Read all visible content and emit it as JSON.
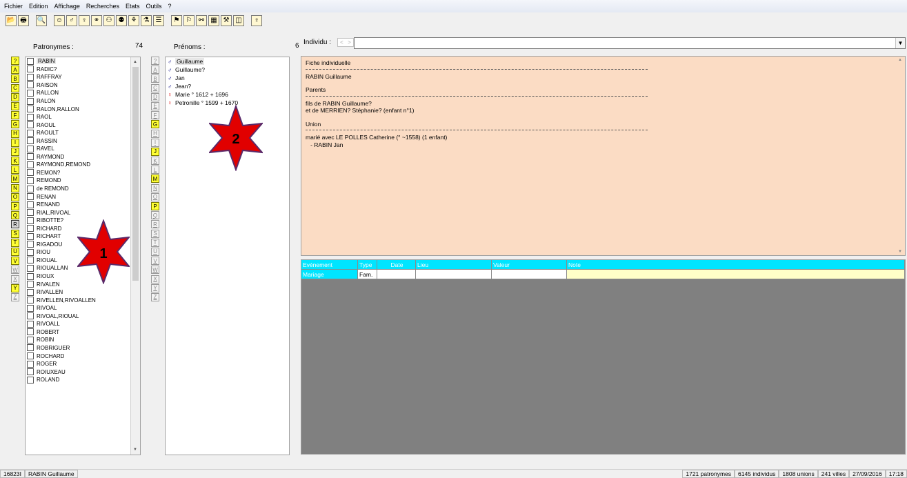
{
  "menu": [
    "Fichier",
    "Edition",
    "Affichage",
    "Recherches",
    "Etats",
    "Outils",
    "?"
  ],
  "toolbar": [
    {
      "icon": "open-folder-icon",
      "glyph": "📂"
    },
    {
      "icon": "print-icon",
      "glyph": "🖶"
    },
    {
      "icon": "binoculars-icon",
      "glyph": "🔍"
    },
    {
      "icon": "smiley-icon",
      "glyph": "☺"
    },
    {
      "icon": "male-person-icon",
      "glyph": "♂"
    },
    {
      "icon": "female-person-icon",
      "glyph": "♀"
    },
    {
      "icon": "couple-icon",
      "glyph": "⚭"
    },
    {
      "icon": "family-icon",
      "glyph": "⚇"
    },
    {
      "icon": "siblings-icon",
      "glyph": "⚉"
    },
    {
      "icon": "tree-icon",
      "glyph": "⚘"
    },
    {
      "icon": "descendants-icon",
      "glyph": "⚗"
    },
    {
      "icon": "list-icon",
      "glyph": "☰"
    },
    {
      "icon": "card-icon",
      "glyph": "⚑"
    },
    {
      "icon": "map-icon",
      "glyph": "⚐"
    },
    {
      "icon": "link-icon",
      "glyph": "⚯"
    },
    {
      "icon": "calendar-icon",
      "glyph": "▦"
    },
    {
      "icon": "tools-icon",
      "glyph": "⚒"
    },
    {
      "icon": "window-icon",
      "glyph": "◫"
    },
    {
      "icon": "lightbulb-icon",
      "glyph": "♀"
    }
  ],
  "surnames_panel": {
    "label": "Patronymes :",
    "count": "74",
    "letters": [
      {
        "l": "?",
        "s": "on"
      },
      {
        "l": "A",
        "s": "on"
      },
      {
        "l": "B",
        "s": "on"
      },
      {
        "l": "C",
        "s": "on"
      },
      {
        "l": "D",
        "s": "on"
      },
      {
        "l": "E",
        "s": "on"
      },
      {
        "l": "F",
        "s": "on"
      },
      {
        "l": "G",
        "s": "on"
      },
      {
        "l": "H",
        "s": "on"
      },
      {
        "l": "I",
        "s": "on"
      },
      {
        "l": "J",
        "s": "on"
      },
      {
        "l": "K",
        "s": "on"
      },
      {
        "l": "L",
        "s": "on"
      },
      {
        "l": "M",
        "s": "on"
      },
      {
        "l": "N",
        "s": "on"
      },
      {
        "l": "O",
        "s": "on"
      },
      {
        "l": "P",
        "s": "on"
      },
      {
        "l": "Q",
        "s": "on"
      },
      {
        "l": "R",
        "s": "sel"
      },
      {
        "l": "S",
        "s": "on"
      },
      {
        "l": "T",
        "s": "on"
      },
      {
        "l": "U",
        "s": "on"
      },
      {
        "l": "V",
        "s": "on"
      },
      {
        "l": "W",
        "s": "off"
      },
      {
        "l": "X",
        "s": "off"
      },
      {
        "l": "Y",
        "s": "on"
      },
      {
        "l": "Z",
        "s": "off"
      }
    ],
    "items": [
      "RABIN",
      "RADIC?",
      "RAFFRAY",
      "RAISON",
      "RALLON",
      "RALON",
      "RALON,RALLON",
      "RAOL",
      "RAOUL",
      "RAOULT",
      "RASSIN",
      "RAVEL",
      "RAYMOND",
      "RAYMOND,REMOND",
      "REMON?",
      "REMOND",
      "de REMOND",
      "RENAN",
      "RENAND",
      "RIAL,RIVOAL",
      "RIBOTTE?",
      "RICHARD",
      "RICHART",
      "RIGADOU",
      "RIOU",
      "RIOUAL",
      "RIOUALLAN",
      "RIOUX",
      "RIVALEN",
      "RIVALLEN",
      "RIVELLEN,RIVOALLEN",
      "RIVOAL",
      "RIVOAL,RIOUAL",
      "RIVOALL",
      "ROBERT",
      "ROBIN",
      "ROBRIGUER",
      "ROCHARD",
      "ROGER",
      "ROIUXEAU",
      "ROLAND"
    ]
  },
  "firstnames_panel": {
    "label": "Prénoms :",
    "count": "6",
    "letters": [
      {
        "l": "?",
        "s": "off"
      },
      {
        "l": "A",
        "s": "off"
      },
      {
        "l": "B",
        "s": "off"
      },
      {
        "l": "C",
        "s": "off"
      },
      {
        "l": "D",
        "s": "off"
      },
      {
        "l": "E",
        "s": "off"
      },
      {
        "l": "F",
        "s": "off"
      },
      {
        "l": "G",
        "s": "on"
      },
      {
        "l": "H",
        "s": "off"
      },
      {
        "l": "I",
        "s": "off"
      },
      {
        "l": "J",
        "s": "on"
      },
      {
        "l": "K",
        "s": "off"
      },
      {
        "l": "L",
        "s": "off"
      },
      {
        "l": "M",
        "s": "on"
      },
      {
        "l": "N",
        "s": "off"
      },
      {
        "l": "O",
        "s": "off"
      },
      {
        "l": "P",
        "s": "on"
      },
      {
        "l": "Q",
        "s": "off"
      },
      {
        "l": "R",
        "s": "off"
      },
      {
        "l": "S",
        "s": "off"
      },
      {
        "l": "T",
        "s": "off"
      },
      {
        "l": "U",
        "s": "off"
      },
      {
        "l": "V",
        "s": "off"
      },
      {
        "l": "W",
        "s": "off"
      },
      {
        "l": "X",
        "s": "off"
      },
      {
        "l": "Y",
        "s": "off"
      },
      {
        "l": "Z",
        "s": "off"
      }
    ],
    "items": [
      {
        "sex": "m",
        "text": "Guillaume"
      },
      {
        "sex": "m",
        "text": "Guillaume?"
      },
      {
        "sex": "m",
        "text": "Jan"
      },
      {
        "sex": "m",
        "text": "Jean?"
      },
      {
        "sex": "f",
        "text": "Marie ° 1612 + 1696"
      },
      {
        "sex": "f",
        "text": "Petronille ° 1599 + 1670"
      }
    ],
    "male_symbol": "♂",
    "female_symbol": "♀"
  },
  "individual": {
    "label": "Individu :",
    "prev": "<",
    "next": ">",
    "value": "",
    "dropdown_glyph": "▼"
  },
  "fiche": {
    "title": "Fiche individuelle",
    "name": "RABIN Guillaume",
    "parents_heading": "Parents",
    "parents_line1": "fils de RABIN Guillaume?",
    "parents_line2": "et de MERRIEN? Stéphanie? (enfant n°1)",
    "union_heading": "Union",
    "union_line1": "marié avec LE POLLES Catherine (° ~1558) (1 enfant)",
    "union_line2": "   - RABIN Jan"
  },
  "events": {
    "headers": [
      "Evénement",
      "Type",
      "Date",
      "Lieu",
      "Valeur",
      "Note"
    ],
    "rows": [
      [
        "Mariage",
        "Fam.",
        "",
        "",
        "",
        ""
      ]
    ]
  },
  "annotations": {
    "star1_label": "1",
    "star2_label": "2",
    "star_color": "#e10000"
  },
  "statusbar": {
    "id": "16823I",
    "name": "RABIN Guillaume",
    "patronymes": "1721 patronymes",
    "individus": "6145 individus",
    "unions": "1808 unions",
    "villes": "241 villes",
    "date": "27/09/2016",
    "time": "17:18"
  }
}
